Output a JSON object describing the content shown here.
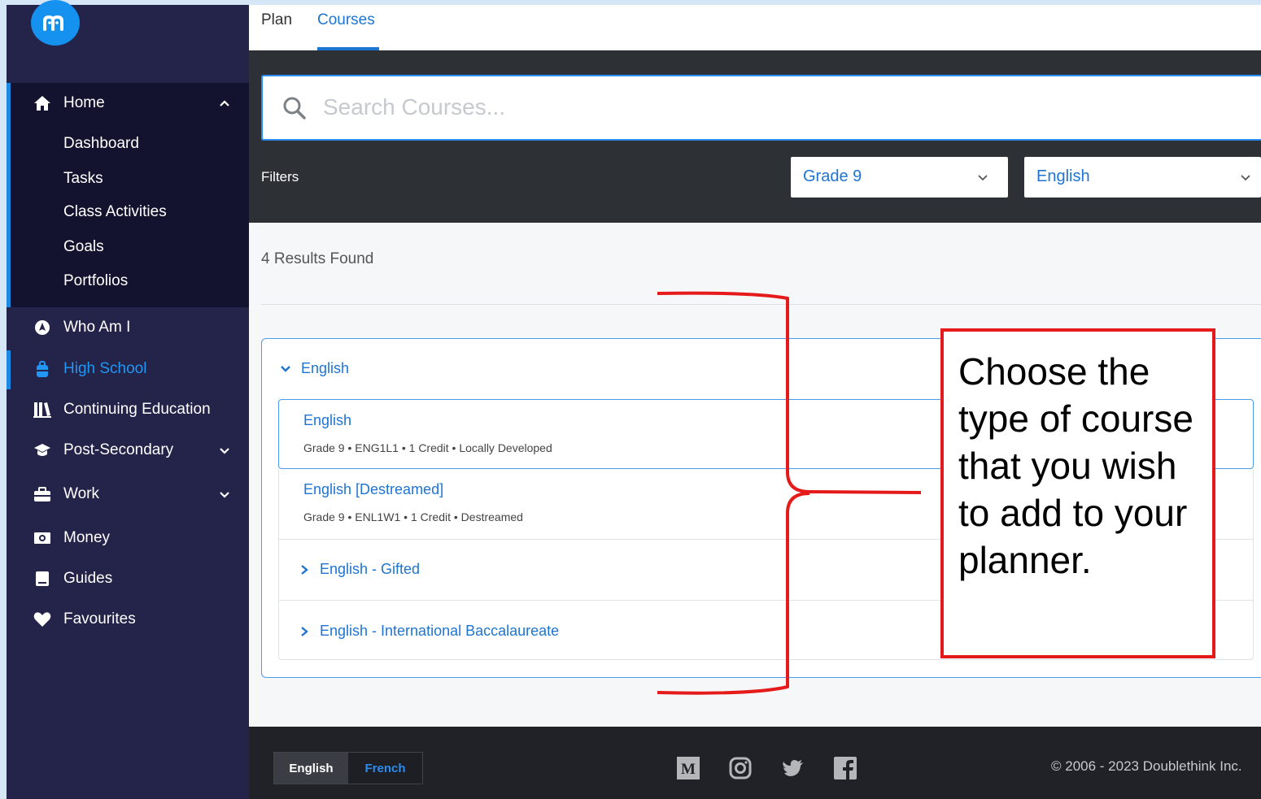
{
  "nav": {
    "home": "Home",
    "home_sub": [
      "Dashboard",
      "Tasks",
      "Class Activities",
      "Goals",
      "Portfolios"
    ],
    "who_am_i": "Who Am I",
    "high_school": "High School",
    "continuing_education": "Continuing Education",
    "post_secondary": "Post-Secondary",
    "work": "Work",
    "money": "Money",
    "guides": "Guides",
    "favourites": "Favourites"
  },
  "tabs": {
    "plan": "Plan",
    "courses": "Courses"
  },
  "search": {
    "placeholder": "Search Courses..."
  },
  "filters": {
    "label": "Filters",
    "grade": "Grade 9",
    "subject": "English"
  },
  "results": {
    "count_text": "4 Results Found"
  },
  "group": {
    "title": "English",
    "courses": [
      {
        "title": "English",
        "meta": "Grade 9 • ENG1L1 • 1 Credit • Locally Developed"
      },
      {
        "title": "English [Destreamed]",
        "meta": "Grade 9 • ENL1W1 • 1 Credit • Destreamed"
      },
      {
        "title": "English - Gifted"
      },
      {
        "title": "English - International Baccalaureate"
      }
    ]
  },
  "footer": {
    "lang_en": "English",
    "lang_fr": "French",
    "copyright": "© 2006 - 2023 Doublethink Inc."
  },
  "annotation": {
    "text": "Choose the type of course that you wish to add to your planner."
  },
  "colors": {
    "accent": "#1e74d2",
    "sidebar": "#24234a",
    "annotation_red": "#e51b1b"
  }
}
